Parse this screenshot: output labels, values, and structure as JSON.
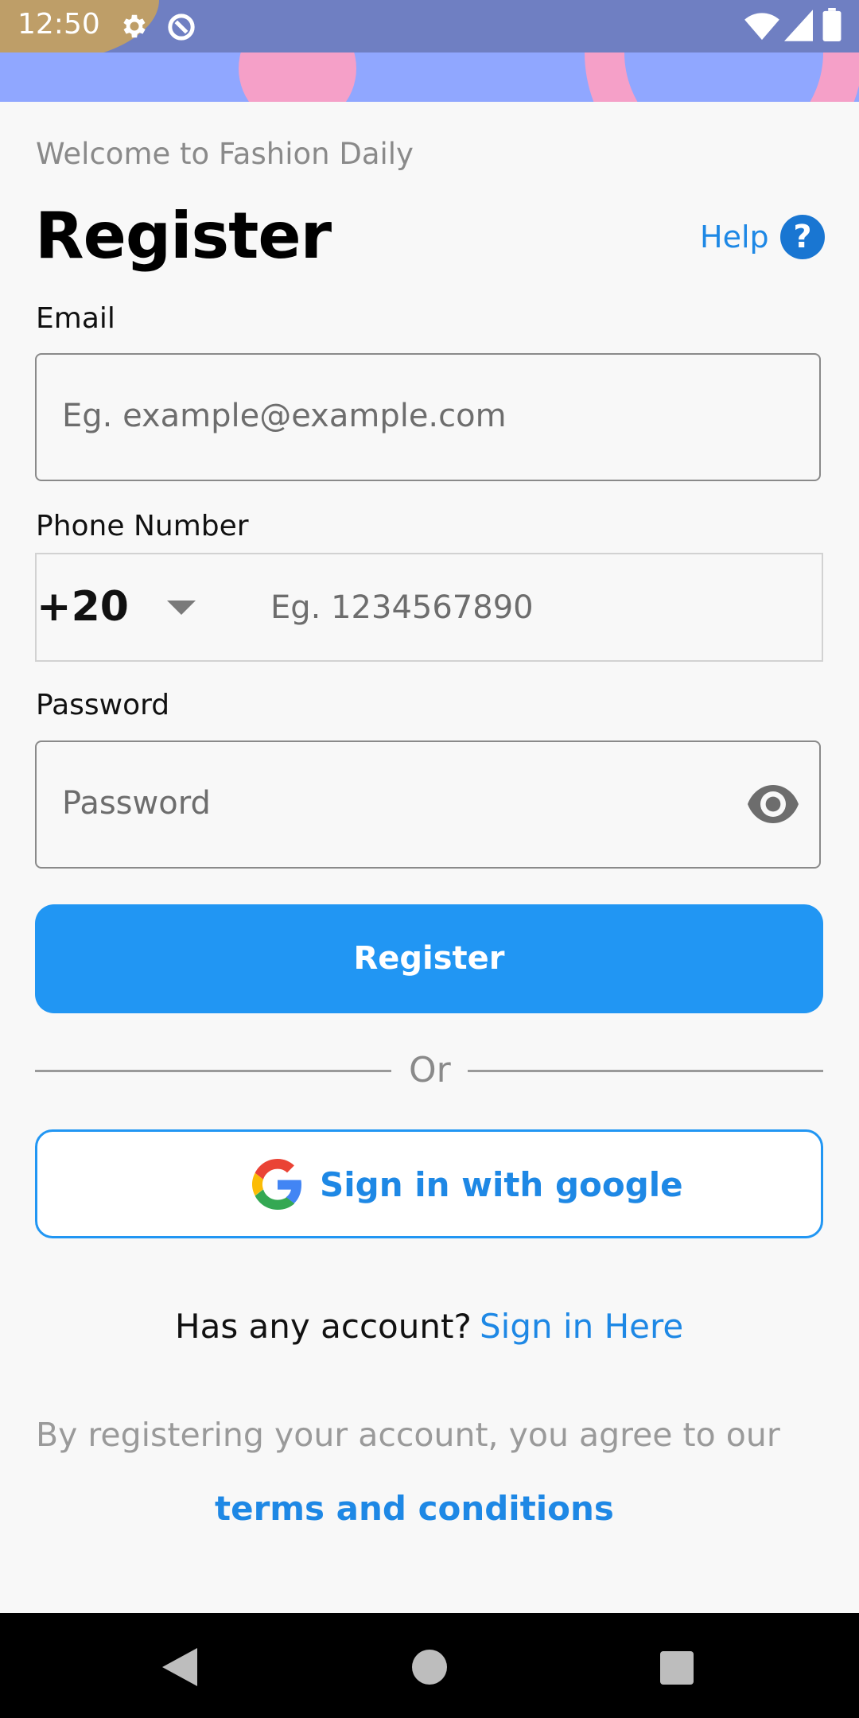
{
  "status_bar": {
    "time": "12:50",
    "icons": [
      "gear-icon",
      "data-saver-icon",
      "wifi-icon",
      "signal-icon",
      "battery-icon"
    ]
  },
  "header": {
    "welcome": "Welcome to Fashion Daily",
    "title": "Register",
    "help_label": "Help",
    "help_icon_glyph": "?"
  },
  "form": {
    "email_label": "Email",
    "email_placeholder": "Eg. example@example.com",
    "phone_label": "Phone Number",
    "country_code": "+20",
    "phone_placeholder": "Eg. 1234567890",
    "password_label": "Password",
    "password_placeholder": "Password",
    "register_button": "Register",
    "or_text": "Or",
    "google_button": "Sign in with google"
  },
  "footer": {
    "account_question": "Has any account?",
    "signin_link": "Sign in Here",
    "agree_text": "By registering your account, you agree to our",
    "terms_link": "terms and conditions"
  },
  "colors": {
    "accent": "#2196f3",
    "link": "#1e88e5",
    "status_bar": "#6f7fc2",
    "banner": "#90a7ff",
    "banner_shapes": "#f5a0c8"
  }
}
